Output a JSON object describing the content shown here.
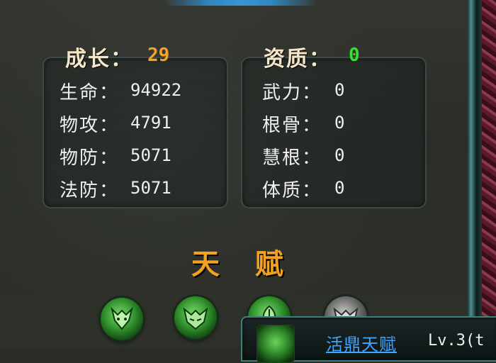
{
  "growth": {
    "label": "成长：",
    "value": "29",
    "stats": [
      {
        "label": "生命：",
        "value": "94922"
      },
      {
        "label": "物攻：",
        "value": "4791"
      },
      {
        "label": "物防：",
        "value": "5071"
      },
      {
        "label": "法防：",
        "value": "5071"
      }
    ]
  },
  "aptitude": {
    "label": "资质：",
    "value": "0",
    "stats": [
      {
        "label": "武力：",
        "value": "0"
      },
      {
        "label": "根骨：",
        "value": "0"
      },
      {
        "label": "慧根：",
        "value": "0"
      },
      {
        "label": "体质：",
        "value": "0"
      }
    ]
  },
  "talent": {
    "title": "天 赋",
    "icons": [
      {
        "icon": "demon-head-icon",
        "state": "active"
      },
      {
        "icon": "demon-mask-icon",
        "state": "active"
      },
      {
        "icon": "leaf-crest-icon",
        "state": "active"
      },
      {
        "icon": "demon-mask-icon",
        "state": "locked"
      }
    ]
  },
  "tooltip": {
    "name": "活鼎天赋",
    "level": "Lv.3(t"
  },
  "colors": {
    "accent_orange": "#f6a227",
    "accent_green": "#36e02e",
    "link_blue": "#3aa6ff"
  }
}
